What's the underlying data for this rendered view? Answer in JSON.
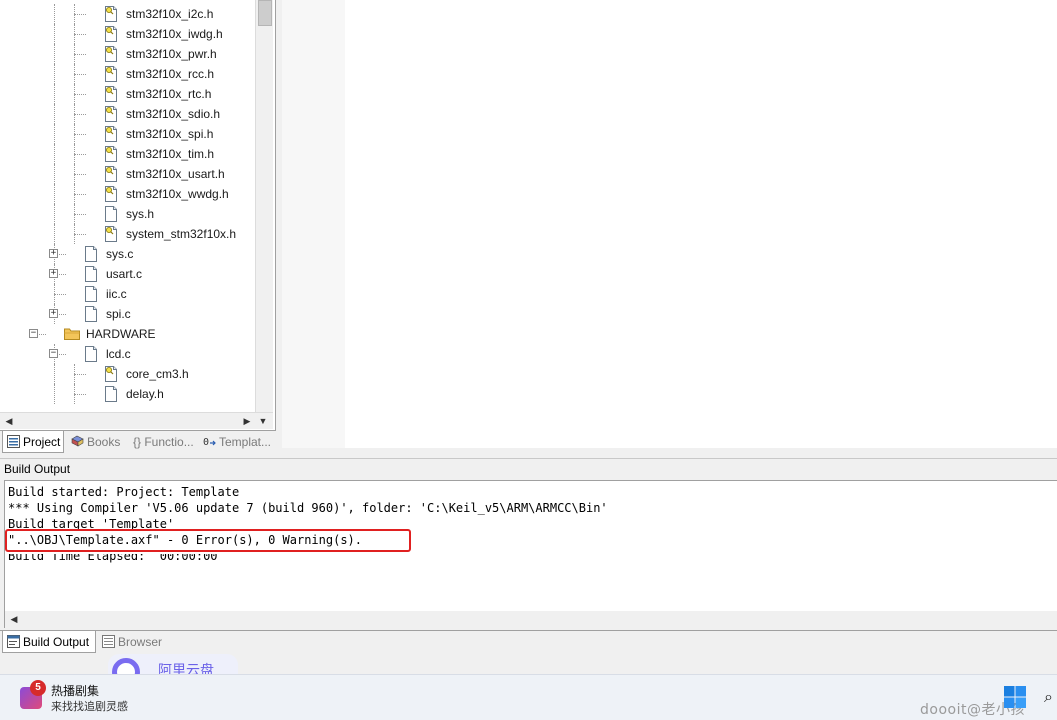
{
  "tree": {
    "rows": [
      {
        "label": "stm32f10x_i2c.h",
        "level": 3,
        "icon": "header-file-icon-yellow",
        "expander": false
      },
      {
        "label": "stm32f10x_iwdg.h",
        "level": 3,
        "icon": "header-file-icon-yellow",
        "expander": false
      },
      {
        "label": "stm32f10x_pwr.h",
        "level": 3,
        "icon": "header-file-icon-yellow",
        "expander": false
      },
      {
        "label": "stm32f10x_rcc.h",
        "level": 3,
        "icon": "header-file-icon-yellow",
        "expander": false
      },
      {
        "label": "stm32f10x_rtc.h",
        "level": 3,
        "icon": "header-file-icon-yellow",
        "expander": false
      },
      {
        "label": "stm32f10x_sdio.h",
        "level": 3,
        "icon": "header-file-icon-yellow",
        "expander": false
      },
      {
        "label": "stm32f10x_spi.h",
        "level": 3,
        "icon": "header-file-icon-yellow",
        "expander": false
      },
      {
        "label": "stm32f10x_tim.h",
        "level": 3,
        "icon": "header-file-icon-yellow",
        "expander": false
      },
      {
        "label": "stm32f10x_usart.h",
        "level": 3,
        "icon": "header-file-icon-yellow",
        "expander": false
      },
      {
        "label": "stm32f10x_wwdg.h",
        "level": 3,
        "icon": "header-file-icon-yellow",
        "expander": false
      },
      {
        "label": "sys.h",
        "level": 3,
        "icon": "file-icon",
        "expander": false
      },
      {
        "label": "system_stm32f10x.h",
        "level": 3,
        "icon": "header-file-icon-yellow",
        "expander": false
      },
      {
        "label": "sys.c",
        "level": 2,
        "icon": "file-icon",
        "expander": "+"
      },
      {
        "label": "usart.c",
        "level": 2,
        "icon": "file-icon",
        "expander": "+"
      },
      {
        "label": "iic.c",
        "level": 2,
        "icon": "file-icon",
        "expander": false
      },
      {
        "label": "spi.c",
        "level": 2,
        "icon": "file-icon",
        "expander": "+"
      },
      {
        "label": "HARDWARE",
        "level": 1,
        "icon": "folder-icon",
        "expander": "-"
      },
      {
        "label": "lcd.c",
        "level": 2,
        "icon": "file-icon",
        "expander": "-"
      },
      {
        "label": "core_cm3.h",
        "level": 3,
        "icon": "header-file-icon-yellow",
        "expander": false
      },
      {
        "label": "delay.h",
        "level": 3,
        "icon": "file-icon",
        "expander": false
      }
    ]
  },
  "project_tabs": [
    {
      "label": "Project",
      "icon": "project-icon",
      "active": true
    },
    {
      "label": "Books",
      "icon": "books-icon",
      "active": false
    },
    {
      "label": "{} Functio...",
      "icon": "",
      "active": false
    },
    {
      "label": "Templat...",
      "icon": "template-icon",
      "active": false
    }
  ],
  "build_output": {
    "header": "Build Output",
    "lines": [
      "Build started: Project: Template",
      "*** Using Compiler 'V5.06 update 7 (build 960)', folder: 'C:\\Keil_v5\\ARM\\ARMCC\\Bin'",
      "Build target 'Template'",
      "\"..\\OBJ\\Template.axf\" - 0 Error(s), 0 Warning(s).",
      "Build Time Elapsed:  00:00:00"
    ],
    "highlight_color": "#e02020"
  },
  "bottom_tabs": [
    {
      "label": "Build Output",
      "icon": "build-output-icon",
      "active": true
    },
    {
      "label": "Browser",
      "icon": "browser-icon",
      "active": false
    }
  ],
  "ad": {
    "text": "阿里云盘"
  },
  "taskbar": {
    "badge": "5",
    "title": "热播剧集",
    "subtitle": "来找找追剧灵感",
    "watermark": "doooit@老小孩"
  }
}
